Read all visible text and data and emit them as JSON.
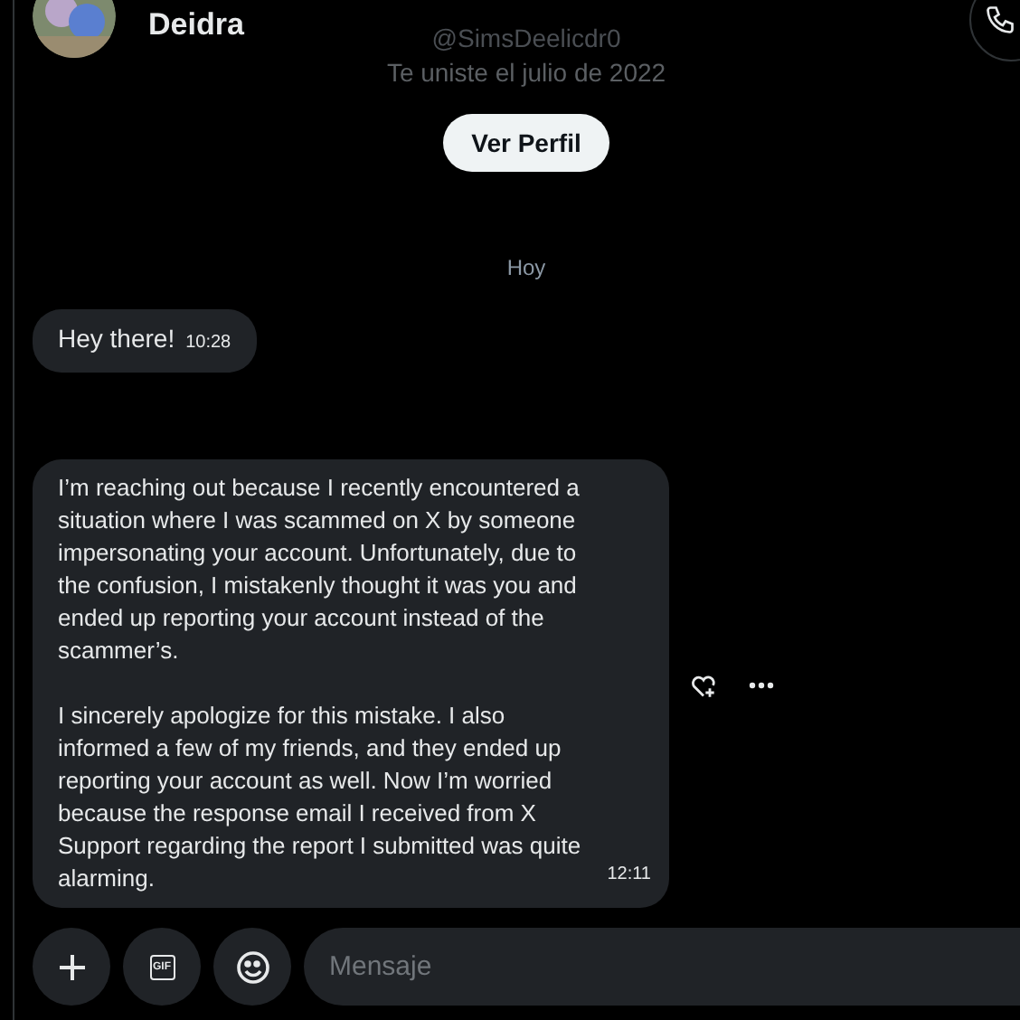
{
  "header": {
    "name": "Deidra"
  },
  "profile": {
    "handle": "@SimsDeelicdr0",
    "joined": "Te uniste el julio de 2022",
    "button": "Ver Perfil"
  },
  "date_divider": "Hoy",
  "messages": [
    {
      "paragraphs": [
        "Hey there!"
      ],
      "time": "10:28",
      "actions": false
    },
    {
      "paragraphs": [
        "I’m reaching out because I recently encountered a situation where I was scammed on X by someone impersonating your account. Unfortunately, due to the confusion, I mistakenly thought it was you and ended up reporting your account instead of the scammer’s.",
        "I sincerely apologize for this mistake. I also informed a few of my friends, and they ended up reporting your account as well. Now I’m worried because the response email I received from X Support regarding the report I submitted was quite alarming."
      ],
      "time": "12:11",
      "actions": true
    }
  ],
  "composer": {
    "placeholder": "Mensaje",
    "gif_label": "GIF"
  }
}
